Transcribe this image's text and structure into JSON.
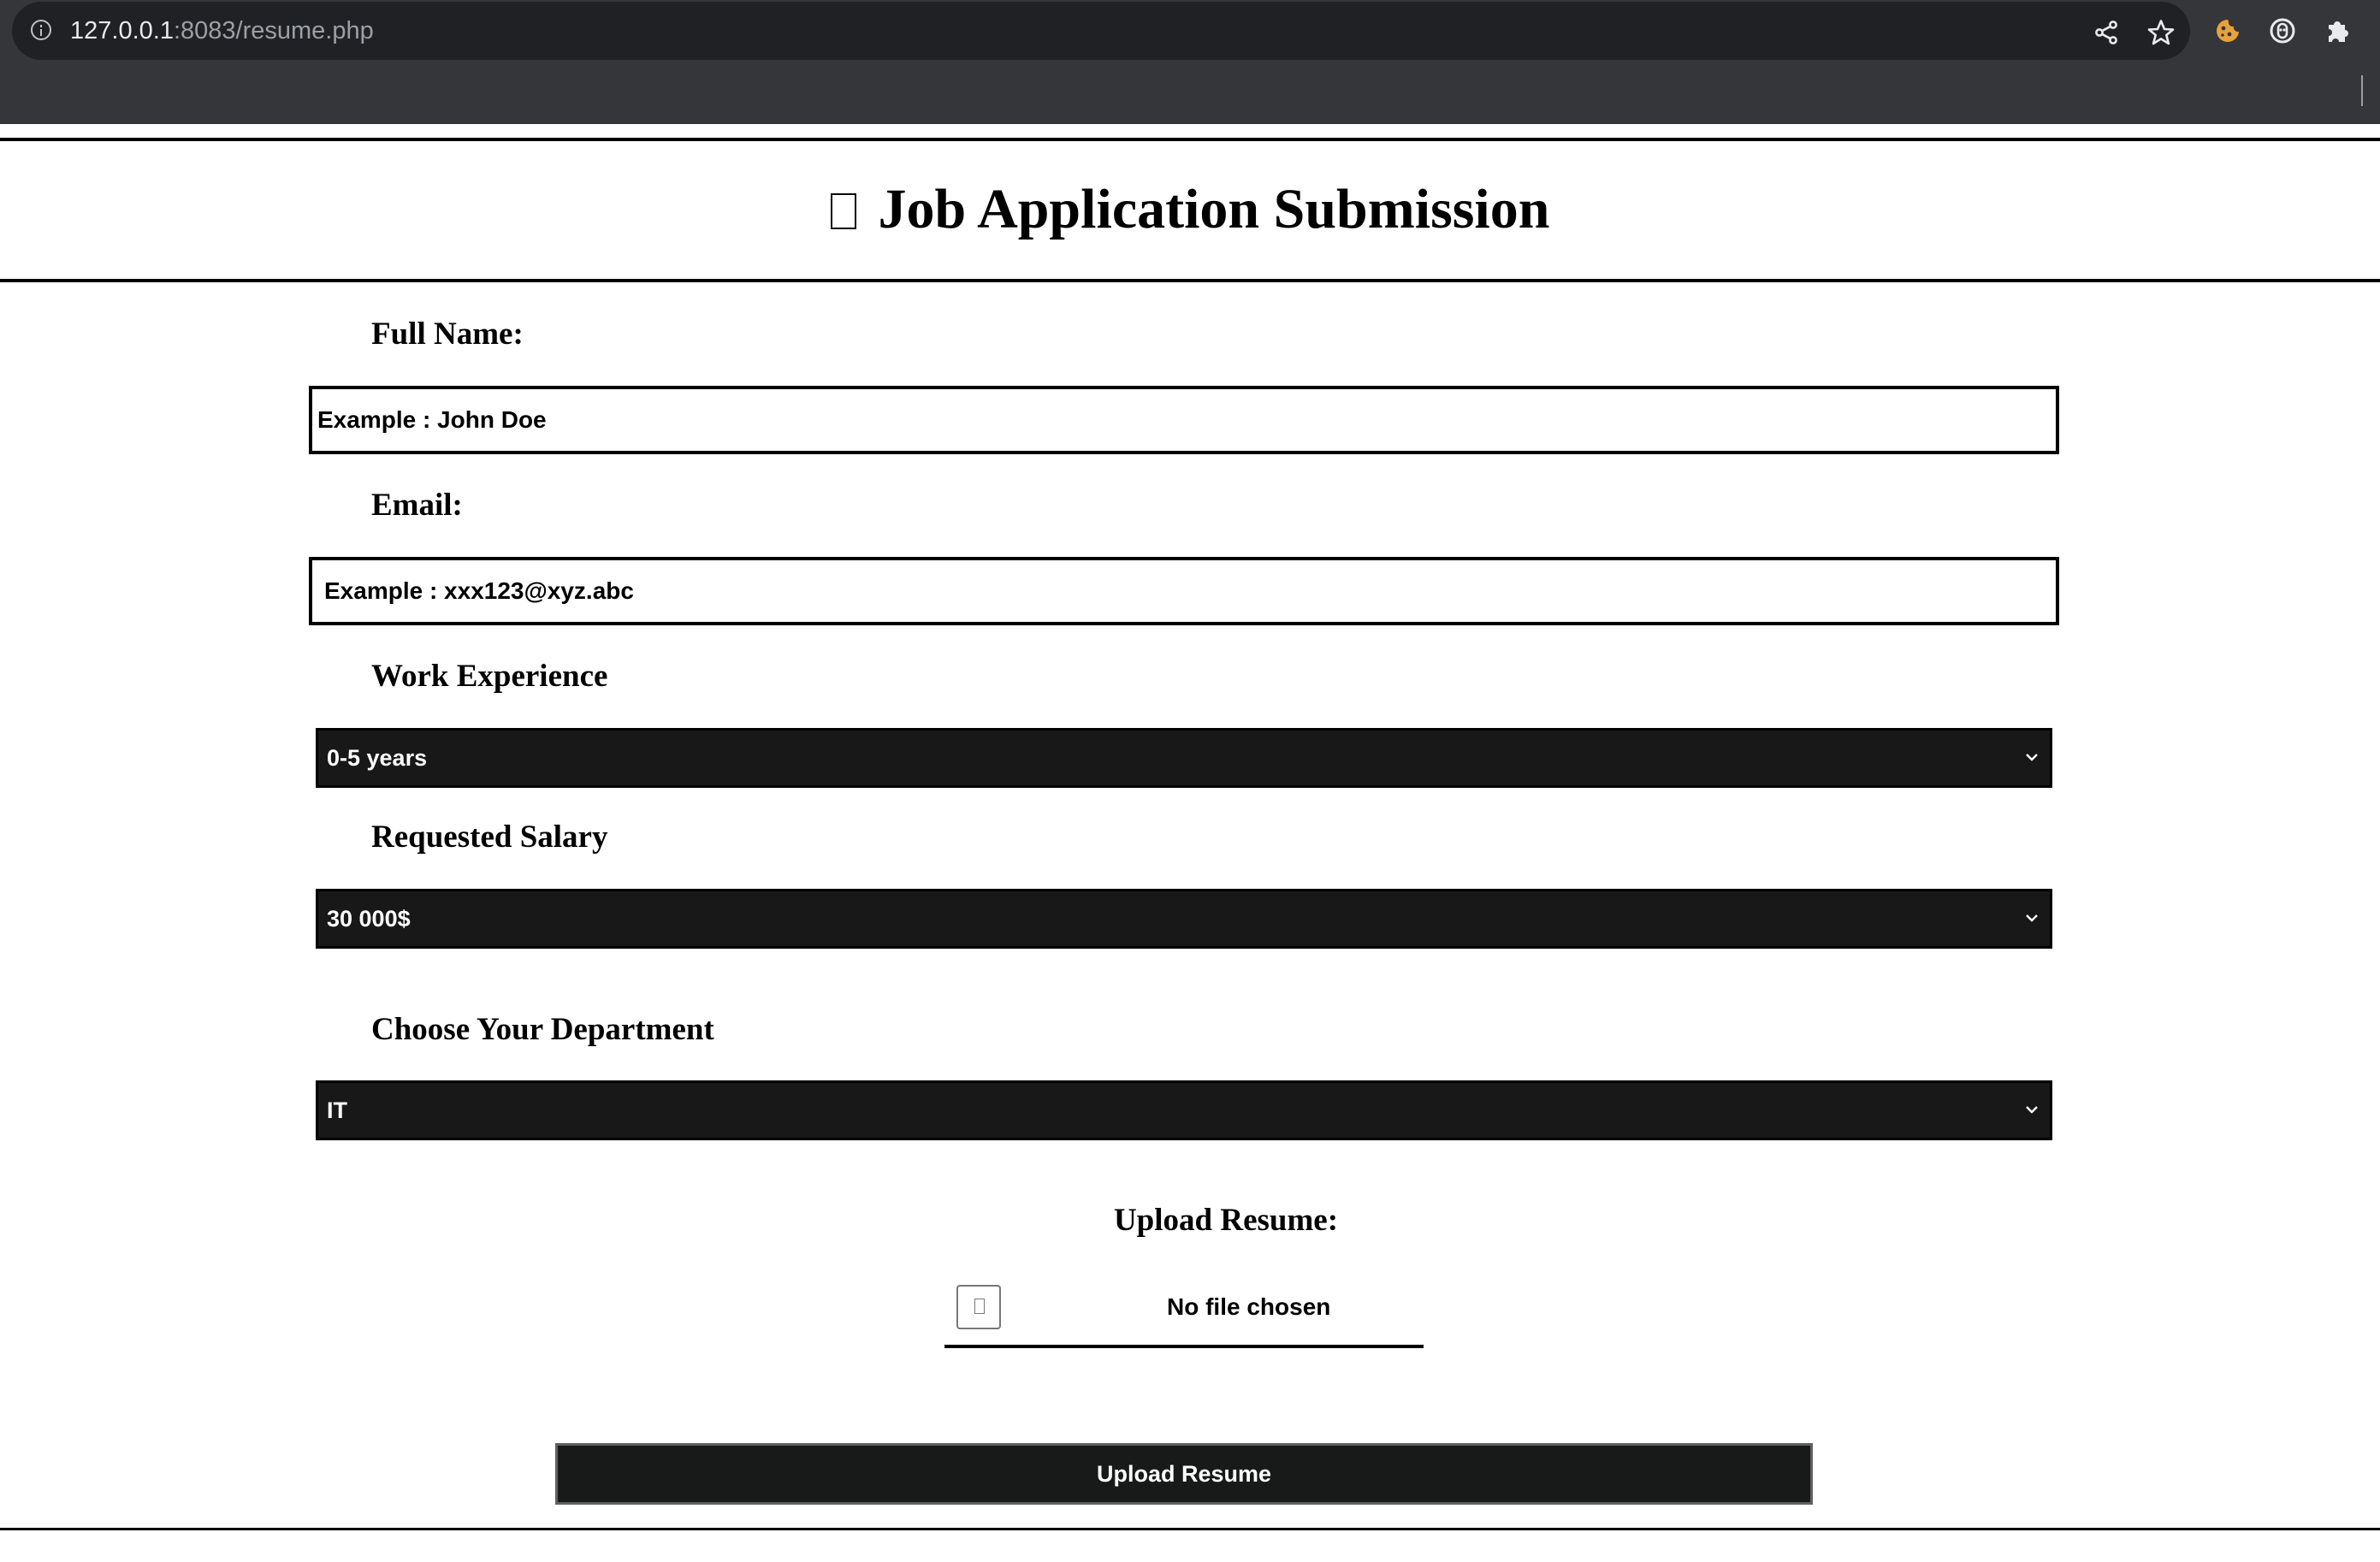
{
  "browser": {
    "url_host": "127.0.0.1",
    "url_path": ":8083/resume.php",
    "icons": [
      "info-icon",
      "share-icon",
      "bookmark-star-icon",
      "cookie-extension-icon",
      "copilot-extension-icon",
      "extensions-puzzle-icon"
    ]
  },
  "page": {
    "title": "Job Application Submission",
    "title_glyph": "missing-glyph-box"
  },
  "form": {
    "full_name": {
      "label": "Full Name:",
      "placeholder": "Example : John Doe",
      "value": ""
    },
    "email": {
      "label": "Email:",
      "placeholder": "Example : xxx123@xyz.abc",
      "value": ""
    },
    "work_experience": {
      "label": "Work Experience",
      "selected": "0-5 years"
    },
    "requested_salary": {
      "label": "Requested Salary",
      "selected": "30 000$"
    },
    "department": {
      "label": "Choose Your Department",
      "selected": "IT"
    },
    "resume": {
      "label": "Upload Resume:",
      "status": "No file chosen"
    },
    "submit_label": "Upload Resume"
  },
  "colors": {
    "chrome_bg": "#35363a",
    "omnibox_bg": "#202124",
    "select_bg": "#181818",
    "button_bg": "#181a1a",
    "extension_accent": "#e8a23a"
  }
}
